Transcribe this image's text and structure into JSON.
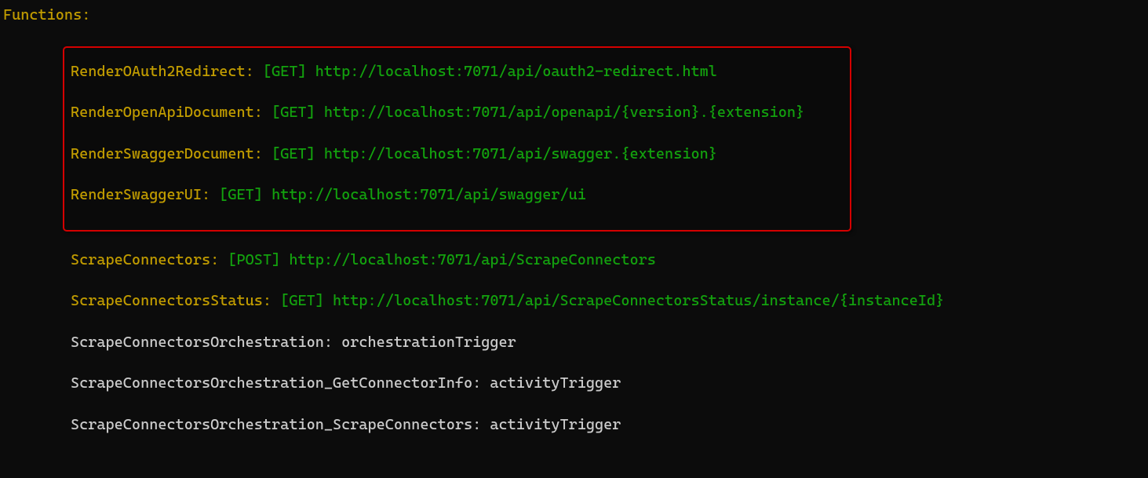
{
  "header": "Functions:",
  "highlighted": [
    {
      "name": "RenderOAuth2Redirect:",
      "method": "[GET]",
      "url": "http://localhost:7071/api/oauth2-redirect.html"
    },
    {
      "name": "RenderOpenApiDocument:",
      "method": "[GET]",
      "url": "http://localhost:7071/api/openapi/{version}.{extension}"
    },
    {
      "name": "RenderSwaggerDocument:",
      "method": "[GET]",
      "url": "http://localhost:7071/api/swagger.{extension}"
    },
    {
      "name": "RenderSwaggerUI:",
      "method": "[GET]",
      "url": "http://localhost:7071/api/swagger/ui"
    }
  ],
  "httpFns": [
    {
      "name": "ScrapeConnectors:",
      "method": "[POST]",
      "url": "http://localhost:7071/api/ScrapeConnectors"
    },
    {
      "name": "ScrapeConnectorsStatus:",
      "method": "[GET]",
      "url": "http://localhost:7071/api/ScrapeConnectorsStatus/instance/{instanceId}"
    }
  ],
  "triggerFns": [
    {
      "name": "ScrapeConnectorsOrchestration:",
      "type": "orchestrationTrigger"
    },
    {
      "name": "ScrapeConnectorsOrchestration_GetConnectorInfo:",
      "type": "activityTrigger"
    },
    {
      "name": "ScrapeConnectorsOrchestration_ScrapeConnectors:",
      "type": "activityTrigger"
    }
  ]
}
